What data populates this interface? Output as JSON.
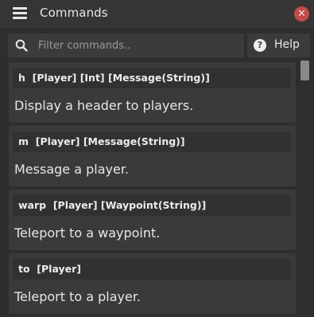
{
  "titlebar": {
    "title": "Commands",
    "menu_icon": "hamburger-menu-icon",
    "close_icon": "close-icon",
    "close_glyph": "✕"
  },
  "toolbar": {
    "search_placeholder": "Filter commands..",
    "search_value": "",
    "help_label": "Help",
    "help_glyph": "?"
  },
  "commands": [
    {
      "name": "h",
      "args": "[Player] [Int] [Message(String)]",
      "description": "Display a header to players."
    },
    {
      "name": "m",
      "args": "[Player] [Message(String)]",
      "description": "Message a player."
    },
    {
      "name": "warp",
      "args": "[Player] [Waypoint(String)]",
      "description": "Teleport to a waypoint."
    },
    {
      "name": "to",
      "args": "[Player]",
      "description": "Teleport to a player."
    }
  ],
  "colors": {
    "close_button": "#c14b4b",
    "background": "#2e2e2e",
    "card": "#3a3a3a"
  }
}
